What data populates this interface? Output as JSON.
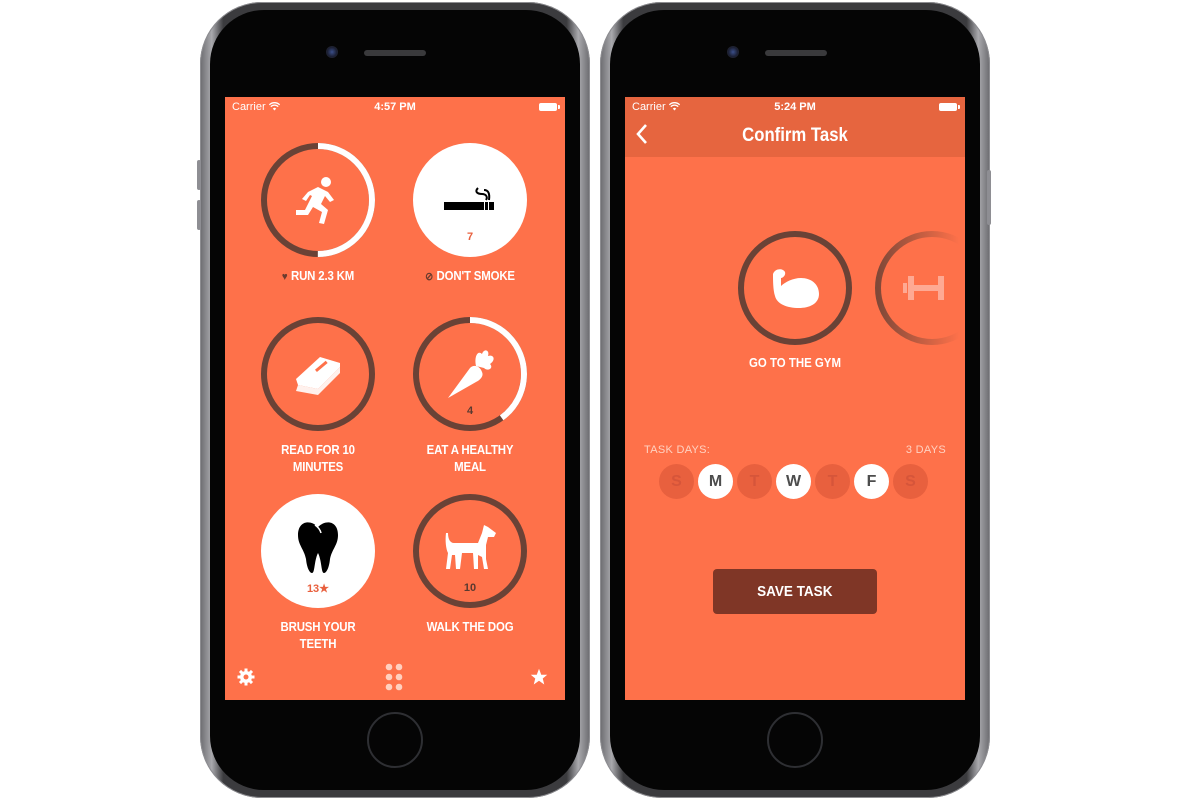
{
  "colors": {
    "screen_bg": "#fe714a",
    "navbar_bg": "#e6653f",
    "ring_dark": "#6a4236",
    "ring_light": "#ffffff",
    "count_accent": "#e8603e",
    "save_button_bg": "#7f3626"
  },
  "left_phone": {
    "status": {
      "carrier": "Carrier",
      "time": "4:57 PM"
    },
    "tasks": [
      {
        "id": "run",
        "label": "RUN 2.3 KM",
        "prefix_icon": "heart-icon",
        "icon": "running-person-icon",
        "count": "",
        "style": "ring",
        "progress": 0.5
      },
      {
        "id": "smoke",
        "label": "DON'T SMOKE",
        "prefix_icon": "prohibited-icon",
        "icon": "cigarette-icon",
        "count": "7",
        "style": "filled",
        "progress": 1
      },
      {
        "id": "read",
        "label": "READ FOR 10 MINUTES",
        "prefix_icon": "",
        "icon": "book-icon",
        "count": "",
        "style": "ring",
        "progress": 0
      },
      {
        "id": "meal",
        "label": "EAT A HEALTHY MEAL",
        "prefix_icon": "",
        "icon": "carrot-icon",
        "count": "4",
        "style": "ring",
        "progress": 0.4
      },
      {
        "id": "teeth",
        "label": "BRUSH YOUR TEETH",
        "prefix_icon": "",
        "icon": "tooth-icon",
        "count": "13★",
        "style": "filled",
        "progress": 1
      },
      {
        "id": "dog",
        "label": "WALK THE DOG",
        "prefix_icon": "",
        "icon": "dog-icon",
        "count": "10",
        "style": "ring",
        "progress": 0
      }
    ],
    "tabbar": {
      "left": "settings-gear-icon",
      "center": "grid-dots-icon",
      "right": "star-icon"
    }
  },
  "right_phone": {
    "status": {
      "carrier": "Carrier",
      "time": "5:24 PM"
    },
    "navbar": {
      "back": "‹",
      "title": "Confirm Task"
    },
    "task": {
      "label": "GO TO THE GYM",
      "icon": "flexed-arm-icon",
      "next_icon": "dumbbell-icon"
    },
    "task_days": {
      "label": "TASK DAYS:",
      "summary": "3 DAYS",
      "days": [
        {
          "letter": "S",
          "selected": false
        },
        {
          "letter": "M",
          "selected": true
        },
        {
          "letter": "T",
          "selected": false
        },
        {
          "letter": "W",
          "selected": true
        },
        {
          "letter": "T",
          "selected": false
        },
        {
          "letter": "F",
          "selected": true
        },
        {
          "letter": "S",
          "selected": false
        }
      ]
    },
    "save_label": "SAVE TASK"
  }
}
